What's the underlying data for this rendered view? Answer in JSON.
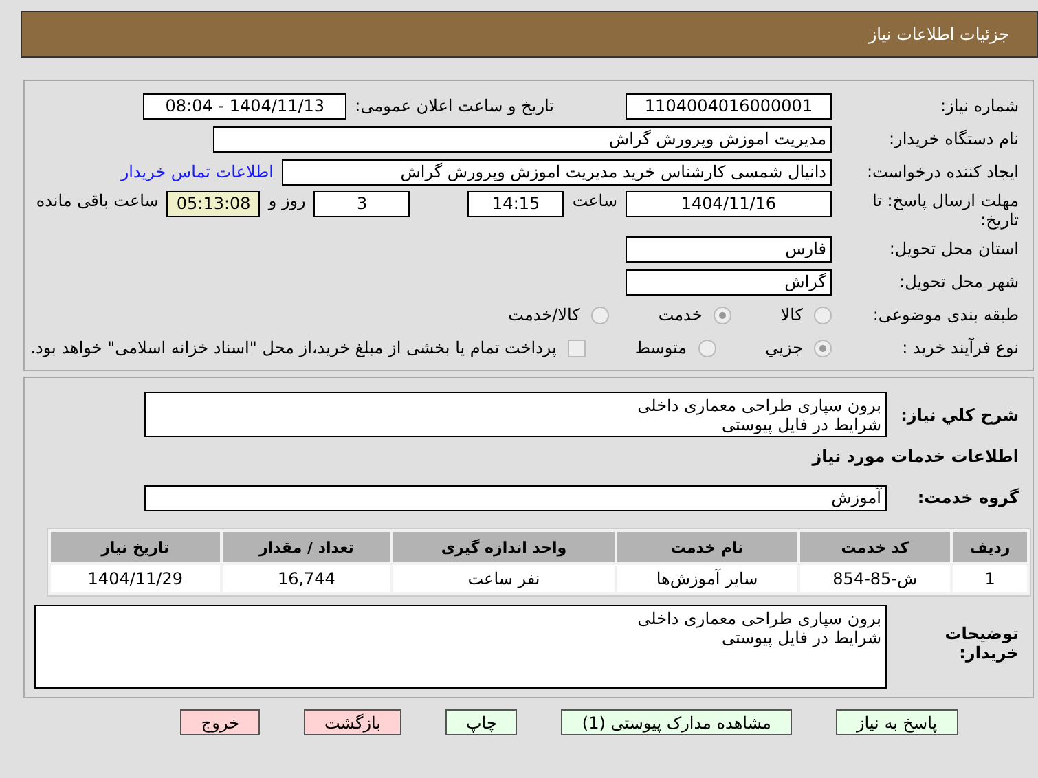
{
  "header": {
    "title": "جزئیات اطلاعات نیاز"
  },
  "need_number": {
    "label": "شماره نیاز:",
    "value": "1104004016000001"
  },
  "announce": {
    "label": "تاریخ و ساعت اعلان عمومی:",
    "value": "1404/11/13 - 08:04"
  },
  "buyer": {
    "label": "نام دستگاه خریدار:",
    "value": "مدیریت اموزش وپرورش گراش"
  },
  "creator": {
    "label": "ایجاد کننده درخواست:",
    "value": "دانیال شمسی کارشناس خرید مدیریت اموزش وپرورش گراش",
    "link": "اطلاعات تماس خریدار"
  },
  "deadline": {
    "label": "مهلت ارسال پاسخ: تا تاریخ:",
    "date": "1404/11/16",
    "time_label": "ساعت",
    "time": "14:15",
    "days": "3",
    "days_label": "روز و",
    "remaining": "05:13:08",
    "remaining_label": "ساعت باقی مانده"
  },
  "province": {
    "label": "استان محل تحویل:",
    "value": "فارس"
  },
  "city": {
    "label": "شهر محل تحویل:",
    "value": "گراش"
  },
  "category": {
    "label": "طبقه بندی موضوعی:",
    "options": [
      {
        "label": "کالا",
        "selected": false
      },
      {
        "label": "خدمت",
        "selected": true
      },
      {
        "label": "کالا/خدمت",
        "selected": false
      }
    ]
  },
  "process": {
    "label": "نوع فرآیند خرید :",
    "options": [
      {
        "label": "جزیي",
        "selected": true
      },
      {
        "label": "متوسط",
        "selected": false
      }
    ],
    "treasury": {
      "checked": false,
      "text": "پرداخت تمام یا بخشی از مبلغ خرید،از محل \"اسناد خزانه اسلامی\" خواهد بود."
    }
  },
  "summary": {
    "label": "شرح کلي نياز:",
    "value": "برون سپاری طراحی معماری داخلی\nشرایط در فایل پیوستی"
  },
  "services_title": "اطلاعات خدمات مورد نیاز",
  "service_group": {
    "label": "گروه خدمت:",
    "value": "آموزش"
  },
  "table": {
    "columns": [
      "ردیف",
      "کد خدمت",
      "نام خدمت",
      "واحد اندازه گیری",
      "تعداد / مقدار",
      "تاریخ نیاز"
    ],
    "rows": [
      [
        "1",
        "ش-85-854",
        "سایر آموزش‌ها",
        "نفر ساعت",
        "16,744",
        "1404/11/29"
      ]
    ]
  },
  "notes": {
    "label": "توضیحات خریدار:",
    "value": "برون سپاری طراحی معماری داخلی\nشرایط در فایل پیوستی"
  },
  "buttons": [
    {
      "label": "پاسخ به نیاز",
      "kind": "normal"
    },
    {
      "label": "مشاهده مدارک پیوستی (1)",
      "kind": "normal"
    },
    {
      "label": "چاپ",
      "kind": "normal"
    },
    {
      "label": "بازگشت",
      "kind": "danger"
    },
    {
      "label": "خروج",
      "kind": "danger"
    }
  ]
}
